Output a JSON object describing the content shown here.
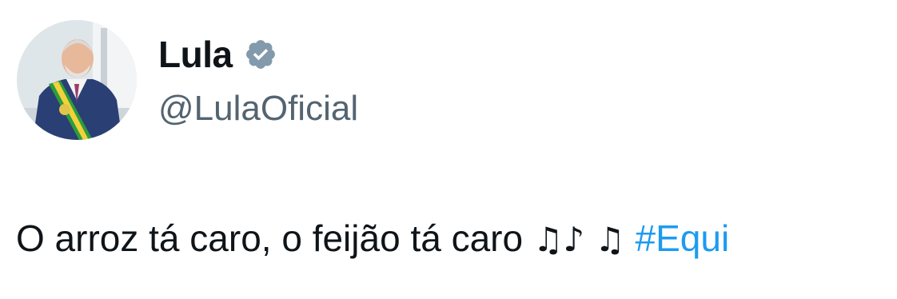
{
  "author": {
    "display_name": "Lula",
    "handle": "@LulaOficial",
    "verified": true
  },
  "tweet": {
    "text": "O arroz tá caro, o feijão tá caro",
    "notes_1": "♫♪",
    "notes_2": "♫",
    "hashtag": "#Equi"
  },
  "colors": {
    "text": "#0f1419",
    "secondary": "#536471",
    "link": "#1d9bf0",
    "verified_badge": "#829aab"
  },
  "icons": {
    "verified": "verified-badge-icon",
    "avatar": "profile-photo"
  }
}
